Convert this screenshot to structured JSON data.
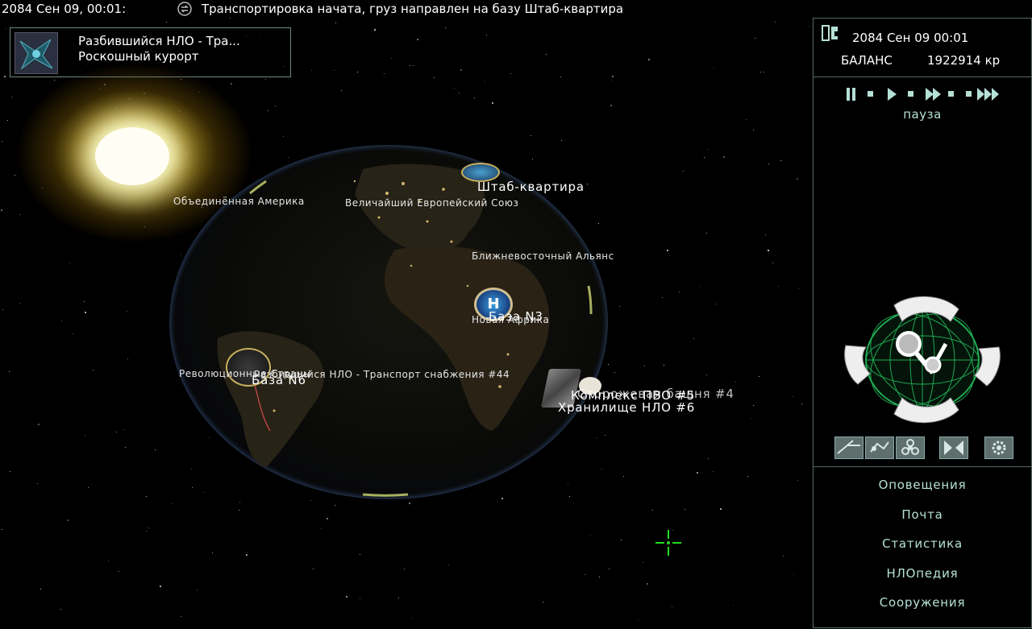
{
  "ticker": {
    "date": "2084 Сен 09, 00:01:",
    "message": "Транспортировка начата, груз направлен на базу Штаб-квартира"
  },
  "event": {
    "line1": "Разбившийся НЛО - Тра...",
    "line2": "Роскошный курорт"
  },
  "globe": {
    "regions": {
      "america": "Объединённая Америка",
      "europe": "Величайший Европейский Союз",
      "mideast": "Ближневосточный Альянс",
      "africa": "Новая Африка",
      "revolution": "Революционные Страны"
    },
    "labels": {
      "hq": "Штаб-квартира",
      "base3": "База N3",
      "base6": "База N6",
      "crash": "Разбившийся НЛО - Транспорт снабжения #44",
      "complex": "Комплекс ПВО #5",
      "tower": "Сторожевая башня #4",
      "storage": "Хранилище НЛО #6"
    }
  },
  "panel": {
    "date": "2084 Сен 09 00:01",
    "balance_label": "БАЛАНС",
    "balance_value": "1922914 кр",
    "speed_label": "пауза",
    "menu": [
      "Оповещения",
      "Почта",
      "Статистика",
      "НЛОпедия",
      "Сооружения"
    ]
  },
  "colors": {
    "panel_border": "#596c63",
    "panel_text": "#b5e0d6",
    "crosshair": "#22dd22",
    "tool_bg": "#5e6f6c"
  },
  "icons": {
    "ticker": "transport-icon",
    "logo": "game-logo-icon",
    "crosshair": "crosshair-icon"
  }
}
